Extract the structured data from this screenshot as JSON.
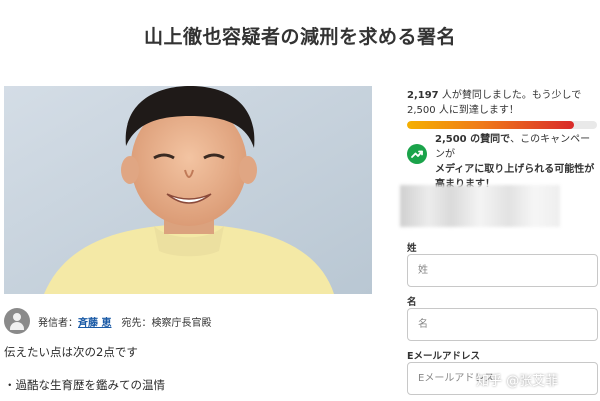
{
  "title": "山上徹也容疑者の減刑を求める署名",
  "starter": {
    "prefix": "発信者：",
    "name": "斉藤 恵",
    "recipient": "宛先：検察庁長官殿"
  },
  "body": {
    "line1": "伝えたい点は次の2点です",
    "line2": "・過酷な生育歴を鑑みての温情"
  },
  "signatures": {
    "count": "2,197",
    "count_suffix": " 人が賛同しました。",
    "remaining_text": "もう少しで",
    "goal": "2,500",
    "goal_suffix": " 人に到達します！",
    "progress_fraction": 0.879
  },
  "trend": {
    "goal": "2,500",
    "line_mid": " の賛同で",
    "line_rest": "、このキャンペーンが",
    "line2": "メディアに取り上げられる可能性が",
    "line3": "高まります！",
    "icon": "trending-up-icon",
    "color": "#1aa34a"
  },
  "form": {
    "last_name_label": "姓",
    "last_name_placeholder": "姓",
    "first_name_label": "名",
    "first_name_placeholder": "名",
    "email_label": "Eメールアドレス",
    "email_placeholder": "Eメールアドレス"
  },
  "watermark": "知乎 @张艾菲",
  "colors": {
    "progress_start": "#f5b000",
    "progress_end": "#d92a2a",
    "link": "#1a5aa6"
  }
}
